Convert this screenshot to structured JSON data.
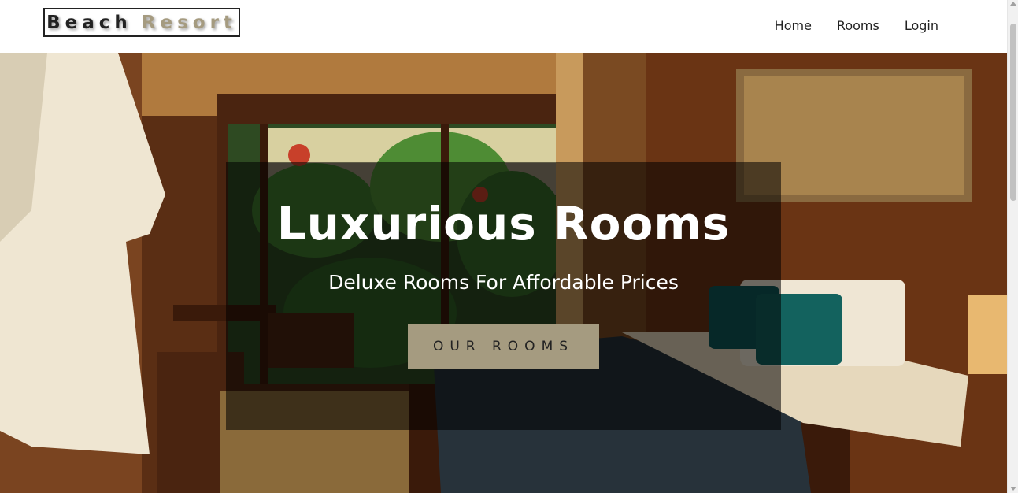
{
  "navbar": {
    "logo": {
      "word1": "Beach",
      "word2": "Resort"
    },
    "links": [
      {
        "label": "Home"
      },
      {
        "label": "Rooms"
      },
      {
        "label": "Login"
      }
    ]
  },
  "hero": {
    "title": "Luxurious Rooms",
    "subtitle": "Deluxe Rooms For Affordable Prices",
    "cta_label": "our rooms",
    "background_image": "hotel bedroom with bed, teal pillows, robe, desk and garden window"
  },
  "colors": {
    "accent": "#a59b80",
    "text_dark": "#222222",
    "banner_overlay": "rgba(0,0,0,0.55)"
  }
}
